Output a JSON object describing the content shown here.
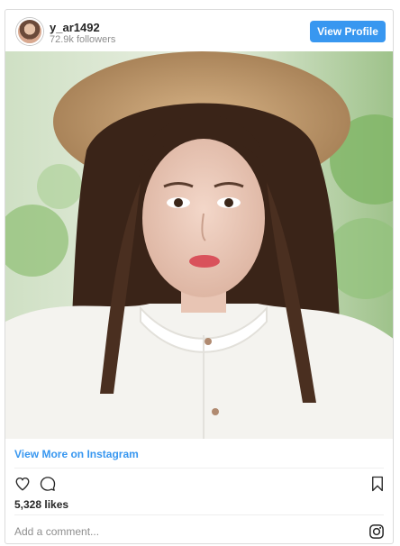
{
  "header": {
    "username": "y_ar1492",
    "followers": "72.9k followers",
    "view_profile_label": "View Profile"
  },
  "post": {
    "view_more_label": "View More on Instagram",
    "likes": "5,328 likes",
    "add_comment_placeholder": "Add a comment...",
    "icons": [
      "heart-icon",
      "comment-icon",
      "bookmark-icon",
      "instagram-icon"
    ]
  },
  "colors": {
    "accent": "#3897f0",
    "border": "#dbdbdb",
    "muted_text": "#8e8e8e",
    "text": "#262626"
  }
}
